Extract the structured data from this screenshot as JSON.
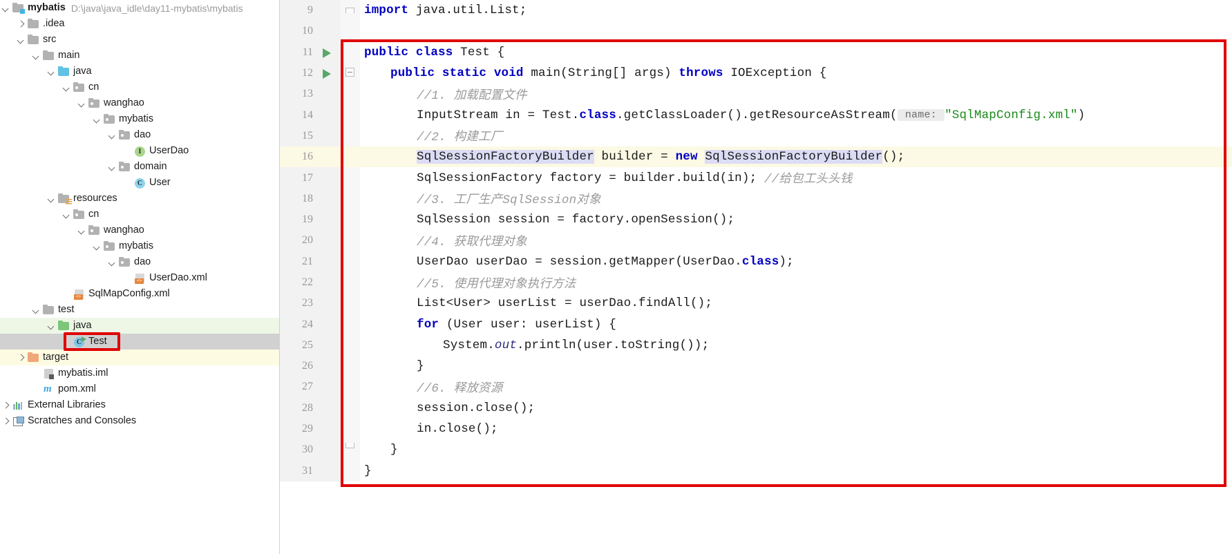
{
  "project_tree": {
    "root_label": "mybatis",
    "root_path": "D:\\java\\java_idle\\day11-mybatis\\mybatis",
    "items": [
      {
        "label": ".idea",
        "depth": 1,
        "arrow": "right",
        "icon": "folder-icon"
      },
      {
        "label": "src",
        "depth": 1,
        "arrow": "down",
        "icon": "folder-icon"
      },
      {
        "label": "main",
        "depth": 2,
        "arrow": "down",
        "icon": "folder-icon"
      },
      {
        "label": "java",
        "depth": 3,
        "arrow": "down",
        "icon": "source-root-folder-icon"
      },
      {
        "label": "cn",
        "depth": 4,
        "arrow": "down",
        "icon": "package-icon"
      },
      {
        "label": "wanghao",
        "depth": 5,
        "arrow": "down",
        "icon": "package-icon"
      },
      {
        "label": "mybatis",
        "depth": 6,
        "arrow": "down",
        "icon": "package-icon"
      },
      {
        "label": "dao",
        "depth": 7,
        "arrow": "down",
        "icon": "package-icon"
      },
      {
        "label": "UserDao",
        "depth": 8,
        "arrow": "none",
        "icon": "java-interface-icon"
      },
      {
        "label": "domain",
        "depth": 7,
        "arrow": "down",
        "icon": "package-icon"
      },
      {
        "label": "User",
        "depth": 8,
        "arrow": "none",
        "icon": "java-class-icon"
      },
      {
        "label": "resources",
        "depth": 3,
        "arrow": "down",
        "icon": "resource-root-folder-icon"
      },
      {
        "label": "cn",
        "depth": 4,
        "arrow": "down",
        "icon": "package-icon"
      },
      {
        "label": "wanghao",
        "depth": 5,
        "arrow": "down",
        "icon": "package-icon"
      },
      {
        "label": "mybatis",
        "depth": 6,
        "arrow": "down",
        "icon": "package-icon"
      },
      {
        "label": "dao",
        "depth": 7,
        "arrow": "down",
        "icon": "package-icon"
      },
      {
        "label": "UserDao.xml",
        "depth": 8,
        "arrow": "none",
        "icon": "xml-file-icon"
      },
      {
        "label": "SqlMapConfig.xml",
        "depth": 4,
        "arrow": "none",
        "icon": "xml-file-icon"
      },
      {
        "label": "test",
        "depth": 2,
        "arrow": "down",
        "icon": "folder-icon"
      },
      {
        "label": "java",
        "depth": 3,
        "arrow": "down",
        "icon": "test-source-root-folder-icon",
        "row_style": "green"
      },
      {
        "label": "Test",
        "depth": 4,
        "arrow": "none",
        "icon": "java-runnable-class-icon",
        "row_style": "grey",
        "highlighted": true
      },
      {
        "label": "target",
        "depth": 1,
        "arrow": "right",
        "icon": "excluded-folder-icon",
        "row_style": "yellow"
      },
      {
        "label": "mybatis.iml",
        "depth": 2,
        "arrow": "none",
        "icon": "iml-file-icon"
      },
      {
        "label": "pom.xml",
        "depth": 2,
        "arrow": "none",
        "icon": "maven-pom-icon"
      },
      {
        "label": "External Libraries",
        "depth": 0,
        "arrow": "right",
        "icon": "libraries-icon"
      },
      {
        "label": "Scratches and Consoles",
        "depth": 0,
        "arrow": "right",
        "icon": "scratches-icon"
      }
    ]
  },
  "editor": {
    "lines": [
      {
        "num": "9",
        "fold": "top",
        "run": false,
        "tokens": [
          {
            "t": "import ",
            "c": "kw"
          },
          {
            "t": "java.util.List;",
            "c": ""
          }
        ],
        "indent": 0
      },
      {
        "num": "10",
        "fold": "none",
        "run": false,
        "tokens": [],
        "indent": 0
      },
      {
        "num": "11",
        "fold": "none",
        "run": true,
        "tokens": [
          {
            "t": "public class ",
            "c": "kw"
          },
          {
            "t": "Test {",
            "c": ""
          }
        ],
        "indent": 0
      },
      {
        "num": "12",
        "fold": "minus",
        "run": true,
        "tokens": [
          {
            "t": "public static void ",
            "c": "kw"
          },
          {
            "t": "main(String[] args) ",
            "c": ""
          },
          {
            "t": "throws ",
            "c": "kw"
          },
          {
            "t": "IOException {",
            "c": ""
          }
        ],
        "indent": 1
      },
      {
        "num": "13",
        "fold": "none",
        "run": false,
        "tokens": [
          {
            "t": "//1. 加载配置文件",
            "c": "cmt"
          }
        ],
        "indent": 2
      },
      {
        "num": "14",
        "fold": "none",
        "run": false,
        "tokens": [
          {
            "t": "InputStream in = Test.",
            "c": ""
          },
          {
            "t": "class",
            "c": "kw"
          },
          {
            "t": ".getClassLoader().getResourceAsStream(",
            "c": ""
          },
          {
            "t": " name: ",
            "c": "hintp"
          },
          {
            "t": "\"SqlMapConfig.xml\"",
            "c": "str"
          },
          {
            "t": ")",
            "c": ""
          }
        ],
        "indent": 2
      },
      {
        "num": "15",
        "fold": "none",
        "run": false,
        "tokens": [
          {
            "t": "//2. 构建工厂",
            "c": "cmt"
          }
        ],
        "indent": 2
      },
      {
        "num": "16",
        "fold": "none",
        "run": false,
        "highlight": true,
        "tokens": [
          {
            "t": "SqlSessionFactoryBuilder",
            "c": "sel"
          },
          {
            "t": " builder = ",
            "c": ""
          },
          {
            "t": "new ",
            "c": "kw"
          },
          {
            "t": "SqlSessionFactoryBuilder",
            "c": "sel"
          },
          {
            "t": "();",
            "c": ""
          }
        ],
        "indent": 2
      },
      {
        "num": "17",
        "fold": "none",
        "run": false,
        "tokens": [
          {
            "t": "SqlSessionFactory factory = builder.build(in); ",
            "c": ""
          },
          {
            "t": "//给包工头头钱",
            "c": "cmt"
          }
        ],
        "indent": 2
      },
      {
        "num": "18",
        "fold": "none",
        "run": false,
        "tokens": [
          {
            "t": "//3. 工厂生产SqlSession对象",
            "c": "cmt"
          }
        ],
        "indent": 2
      },
      {
        "num": "19",
        "fold": "none",
        "run": false,
        "tokens": [
          {
            "t": "SqlSession session = factory.openSession();",
            "c": ""
          }
        ],
        "indent": 2
      },
      {
        "num": "20",
        "fold": "none",
        "run": false,
        "tokens": [
          {
            "t": "//4. 获取代理对象",
            "c": "cmt"
          }
        ],
        "indent": 2
      },
      {
        "num": "21",
        "fold": "none",
        "run": false,
        "tokens": [
          {
            "t": "UserDao userDao = session.getMapper(UserDao.",
            "c": ""
          },
          {
            "t": "class",
            "c": "kw"
          },
          {
            "t": ");",
            "c": ""
          }
        ],
        "indent": 2
      },
      {
        "num": "22",
        "fold": "none",
        "run": false,
        "tokens": [
          {
            "t": "//5. 使用代理对象执行方法",
            "c": "cmt"
          }
        ],
        "indent": 2
      },
      {
        "num": "23",
        "fold": "none",
        "run": false,
        "tokens": [
          {
            "t": "List<User> userList = userDao.findAll();",
            "c": ""
          }
        ],
        "indent": 2
      },
      {
        "num": "24",
        "fold": "none",
        "run": false,
        "tokens": [
          {
            "t": "for ",
            "c": "kw"
          },
          {
            "t": "(User user: userList) {",
            "c": ""
          }
        ],
        "indent": 2
      },
      {
        "num": "25",
        "fold": "none",
        "run": false,
        "tokens": [
          {
            "t": "System.",
            "c": ""
          },
          {
            "t": "out",
            "c": "stat"
          },
          {
            "t": ".println(user.toString());",
            "c": ""
          }
        ],
        "indent": 3
      },
      {
        "num": "26",
        "fold": "none",
        "run": false,
        "tokens": [
          {
            "t": "}",
            "c": ""
          }
        ],
        "indent": 2
      },
      {
        "num": "27",
        "fold": "none",
        "run": false,
        "tokens": [
          {
            "t": "//6. 释放资源",
            "c": "cmt"
          }
        ],
        "indent": 2
      },
      {
        "num": "28",
        "fold": "none",
        "run": false,
        "tokens": [
          {
            "t": "session.close();",
            "c": ""
          }
        ],
        "indent": 2
      },
      {
        "num": "29",
        "fold": "none",
        "run": false,
        "tokens": [
          {
            "t": "in.close();",
            "c": ""
          }
        ],
        "indent": 2
      },
      {
        "num": "30",
        "fold": "bottom",
        "run": false,
        "tokens": [
          {
            "t": "}",
            "c": ""
          }
        ],
        "indent": 1
      },
      {
        "num": "31",
        "fold": "none",
        "run": false,
        "tokens": [
          {
            "t": "}",
            "c": ""
          }
        ],
        "indent": 0
      }
    ]
  },
  "colors": {
    "highlight_red": "#e00000",
    "keyword_blue": "#0000c0",
    "comment_grey": "#9a9a9a",
    "string_green": "#1a8a1a",
    "selection_lavender": "#dcdcf5",
    "current_line_yellow": "#fcf9e4",
    "tree_selected_grey": "#d1d1d1",
    "test_root_green": "#eef7e6",
    "excluded_yellow": "#fdfbe2"
  }
}
